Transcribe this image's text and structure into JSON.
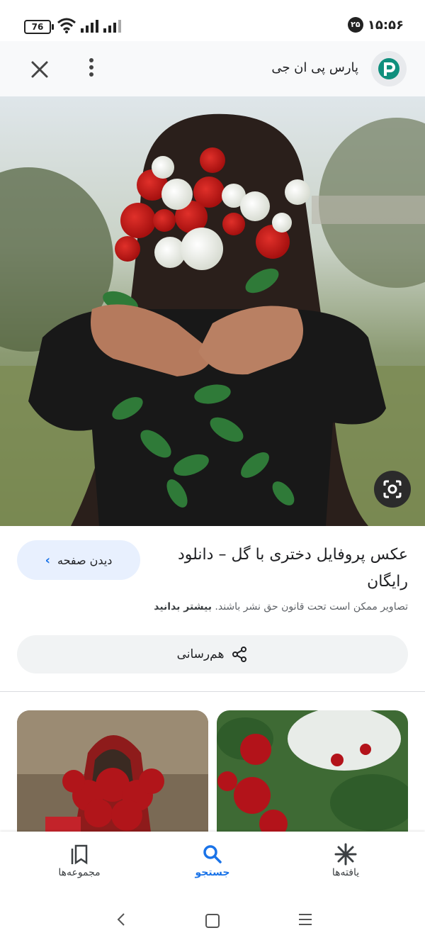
{
  "status_bar": {
    "battery": "76",
    "time": "۱۵:۵۶",
    "notification_count": "۲۵"
  },
  "header": {
    "site_name": "پارس پی ان جی",
    "logo_icon": "parspng-logo"
  },
  "result": {
    "title": "عکس پروفایل دختری با گل – دانلود رایگان",
    "visit_label": "دیدن صفحه",
    "copyright_text": "تصاویر ممکن است تحت قانون حق نشر باشند.",
    "learn_more": "بیشتر بدانید",
    "share_label": "هم‌رسانی"
  },
  "bottom_nav": [
    {
      "label": "مجموعه‌ها",
      "icon": "bookmarks-icon"
    },
    {
      "label": "جستجو",
      "icon": "search-icon",
      "active": true
    },
    {
      "label": "یافته‌ها",
      "icon": "discover-asterisk-icon"
    }
  ],
  "colors": {
    "accent": "#1a73e8",
    "header_bg": "#f8f9fa",
    "logo_teal": "#0f8f7d"
  }
}
